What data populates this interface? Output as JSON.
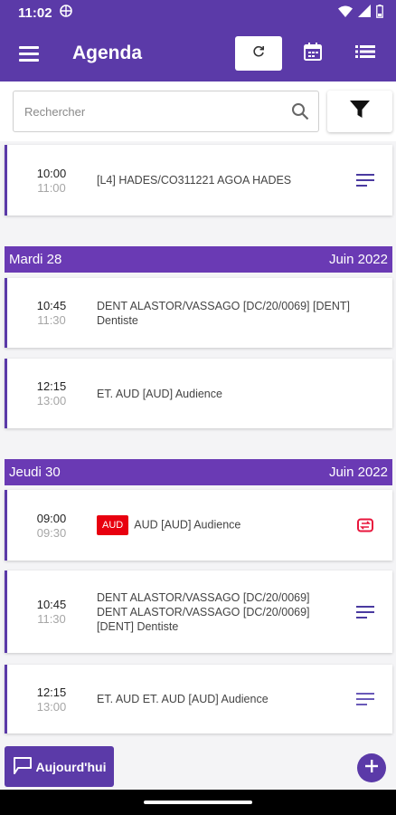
{
  "status": {
    "time": "11:02"
  },
  "header": {
    "title": "Agenda"
  },
  "search": {
    "placeholder": "Rechercher",
    "value": ""
  },
  "first_card": {
    "start": "10:00",
    "end": "11:00",
    "text": "[L4]  HADES/CO311221 AGOA HADES"
  },
  "day1": {
    "day": "Mardi 28",
    "month": "Juin 2022"
  },
  "day1_events": [
    {
      "start": "10:45",
      "end": "11:30",
      "line1": "DENT ALASTOR/VASSAGO [DC/20/0069] [DENT]",
      "line2": "Dentiste"
    },
    {
      "start": "12:15",
      "end": "13:00",
      "text": "ET. AUD [AUD] Audience"
    }
  ],
  "day2": {
    "day": "Jeudi 30",
    "month": "Juin 2022"
  },
  "day2_events": [
    {
      "start": "09:00",
      "end": "09:30",
      "badge": "AUD",
      "text": "AUD [AUD] Audience"
    },
    {
      "start": "10:45",
      "end": "11:30",
      "line1": "DENT ALASTOR/VASSAGO [DC/20/0069]",
      "line2": "DENT ALASTOR/VASSAGO [DC/20/0069]",
      "line3": "[DENT] Dentiste"
    },
    {
      "start": "12:15",
      "end": "13:00",
      "text": "ET. AUD ET. AUD [AUD] Audience"
    }
  ],
  "footer": {
    "today_label": "Aujourd'hui"
  },
  "colors": {
    "primary": "#5b3aa8",
    "day_header": "#6a3ab4",
    "badge": "#e8000f"
  }
}
